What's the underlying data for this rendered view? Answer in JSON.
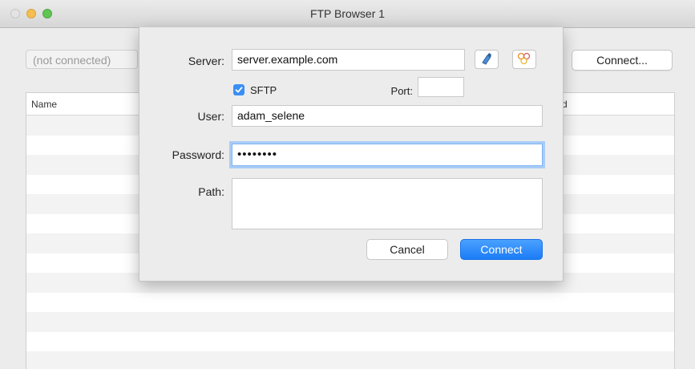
{
  "window": {
    "title": "FTP Browser 1",
    "status": "(not connected)",
    "connect_label": "Connect..."
  },
  "table": {
    "columns": [
      "Name",
      "d"
    ],
    "row_count": 13
  },
  "dialog": {
    "server_label": "Server:",
    "server_value": "server.example.com",
    "sftp_label": "SFTP",
    "sftp_checked": true,
    "port_label": "Port:",
    "port_value": "",
    "user_label": "User:",
    "user_value": "adam_selene",
    "password_label": "Password:",
    "password_value": "••••••••",
    "path_label": "Path:",
    "path_value": "",
    "cancel_label": "Cancel",
    "connect_label": "Connect"
  },
  "icons": {
    "bookmark": "bookmark-icon",
    "bonjour": "bonjour-icon"
  },
  "colors": {
    "accent": "#1b7cf6",
    "focus_ring": "#7fb3f5"
  }
}
